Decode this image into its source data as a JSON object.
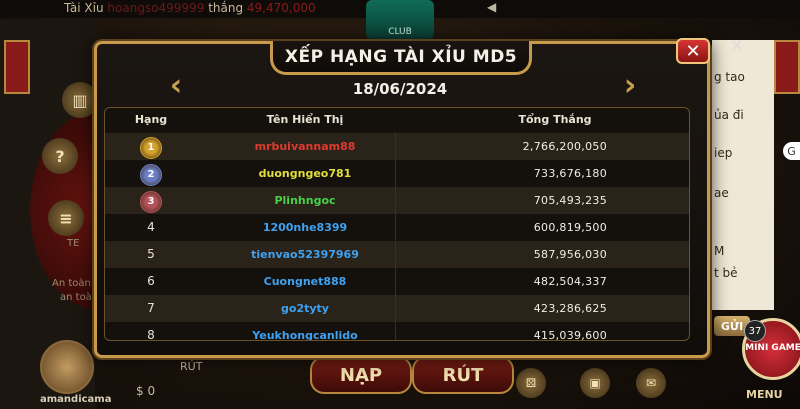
{
  "background": {
    "ticker_prefix": "Tài Xỉu",
    "ticker_user": "hoangso499999",
    "ticker_mid": "thắng",
    "ticker_amount": "49,470,000",
    "right_text_lines": [
      "g tao",
      "ủa đi",
      "iep",
      "ae",
      "M",
      "t bẻ"
    ],
    "send_label": "GỬI",
    "mini_game_label": "MINI GAME",
    "mini_game_badge": "37",
    "menu_label": "MENU",
    "bottom_left_label": "amandicama",
    "bottom_value": "$ 0",
    "nap_label": "NẠP",
    "rut_label": "RÚT",
    "rut_small_label": "RÚT",
    "left_labels": [
      "TE",
      "An toàn",
      "an toàn"
    ]
  },
  "modal": {
    "title": "XẾP HẠNG TÀI XỈU MD5",
    "date": "18/06/2024",
    "prev_icon": "chevron-left-icon",
    "next_icon": "chevron-right-icon",
    "close_icon": "close-icon",
    "columns": {
      "rank": "Hạng",
      "display_name": "Tên Hiển Thị",
      "total_wins": "Tổng Thắng"
    },
    "rows": [
      {
        "rank": "1",
        "name": "mrbuivannam88",
        "amount": "2,766,200,050",
        "name_color": "#e03a2e",
        "medal": true,
        "medal_color": "#d4a12a"
      },
      {
        "rank": "2",
        "name": "duongngeo781",
        "amount": "733,676,180",
        "name_color": "#e3df3a",
        "medal": true,
        "medal_color": "#6b7fc9"
      },
      {
        "rank": "3",
        "name": "Plinhngoc",
        "amount": "705,493,235",
        "name_color": "#47d04a",
        "medal": true,
        "medal_color": "#b4525a"
      },
      {
        "rank": "4",
        "name": "1200nhe8399",
        "amount": "600,819,500",
        "name_color": "#3fa2f0",
        "medal": false
      },
      {
        "rank": "5",
        "name": "tienvao52397969",
        "amount": "587,956,030",
        "name_color": "#3fa2f0",
        "medal": false
      },
      {
        "rank": "6",
        "name": "Cuongnet888",
        "amount": "482,504,337",
        "name_color": "#3fa2f0",
        "medal": false
      },
      {
        "rank": "7",
        "name": "go2tyty",
        "amount": "423,286,625",
        "name_color": "#3fa2f0",
        "medal": false
      },
      {
        "rank": "8",
        "name": "Yeukhongcanlido",
        "amount": "415,039,600",
        "name_color": "#3fa2f0",
        "medal": false
      }
    ]
  }
}
